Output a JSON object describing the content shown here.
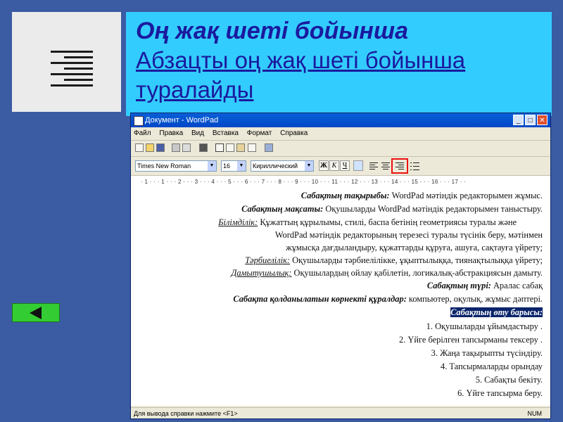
{
  "slide": {
    "heading": "Оң жақ шеті бойынша",
    "description": "Абзацты оң жақ  шеті бойынша туралайды"
  },
  "window": {
    "title": "Документ - WordPad",
    "min_glyph": "_",
    "max_glyph": "□",
    "close_glyph": "✕"
  },
  "menu": [
    "Файл",
    "Правка",
    "Вид",
    "Вставка",
    "Формат",
    "Справка"
  ],
  "format_bar": {
    "font_name": "Times New Roman",
    "font_size": "16",
    "script": "Кириллический",
    "bold": "Ж",
    "italic": "К",
    "underline": "Ч"
  },
  "ruler_text": "· 1 · · · 1 · · · 2 · · · 3 · · · 4 · · · 5 · · · 6 · · · 7 · · · 8 · · · 9 · · · 10 · · · 11 · · · 12 · · · 13 · · · 14 · · · 15 · · · 16 · · · 17 · ·",
  "doc": {
    "l1_label": "Сабақтың тақырыбы:",
    "l1_text": " WordPad мәтіндік редакторымен жұмыс.",
    "l2_label": "Сабақтың мақсаты:",
    "l2_text": " Оқушыларды WordPad мәтіндік редакторымен таныстыру.",
    "l3_label": "Білімділік:",
    "l3_text": "   Құжаттың құрылымы, стилі, баспа бетінің геометриясы туралы және",
    "l4_text": "WordPad мәтіндік редакторының терезесі туралы түсінік беру, мәтінмен",
    "l5_text": "жұмысқа дағдыландыру, құжаттарды құруға, ашуға, сақтауға үйрету;",
    "l6_label": "Тәрбиелілік:",
    "l6_text": " Оқушыларды тәрбиелілікке, ұқыптылыққа, тиянақтылыққа үйрету;",
    "l7_label": "Дамытушылық:",
    "l7_text": " Оқушылардың ойлау қабілетін, логикалық-абстракциясын дамыту.",
    "l8_label": "Сабақтың түрі:",
    "l8_text": " Аралас сабақ",
    "l9_label": "Сабақта қолданылатын көрнекті құралдар:",
    "l9_text": " компьютер, оқулық, жұмыс дәптері.",
    "l10_selected": "Сабақтың өту барысы:",
    "items": [
      "1.  Оқушыларды ұйымдастыру .",
      "2.     Үйге берілген тапсырманы тексеру .",
      "3.  Жаңа тақырыпты түсіндіру.",
      "4.     Тапсырмаларды орындау",
      "5.     Сабақты бекіту.",
      "6.     Үйге тапсырма беру."
    ]
  },
  "status": {
    "hint": "Для вывода справки нажмите <F1>",
    "num": "NUM"
  }
}
